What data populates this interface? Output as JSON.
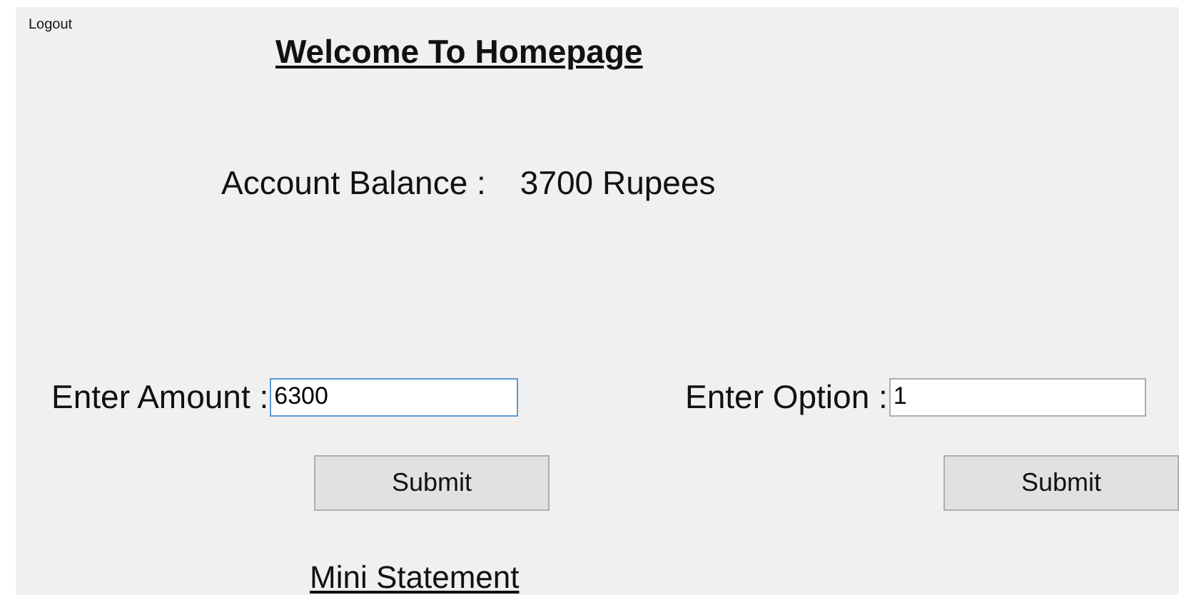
{
  "logout_link": "Logout",
  "title": "Welcome To Homepage",
  "balance": {
    "label": "Account Balance :",
    "value": "3700 Rupees"
  },
  "forms": [
    {
      "label": "Enter Amount :",
      "value": "6300",
      "focused": true,
      "button": "Submit"
    },
    {
      "label": "Enter Option :",
      "value": "1",
      "focused": false,
      "button": "Submit"
    }
  ],
  "mini_statement_link": "Mini Statement"
}
